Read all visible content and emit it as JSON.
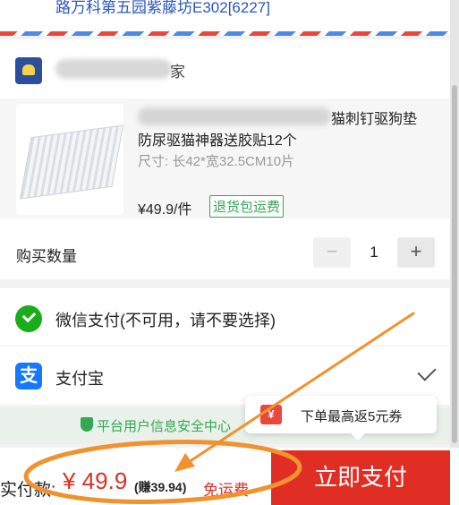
{
  "address": {
    "text": "路万科第五园紫藤坊E302[6227]"
  },
  "shop": {
    "name_suffix": "家",
    "avatar_icon": "shop-avatar-icon"
  },
  "product": {
    "title_line1": "猫刺钉驱狗垫",
    "title_line2": "防尿驱猫神器送胶贴12个",
    "sku": "尺寸: 长42*宽32.5CM10片",
    "price": "¥49.9/件",
    "return_badge": "退货包运费"
  },
  "quantity": {
    "label": "购买数量",
    "minus": "−",
    "value": "1",
    "plus": "+"
  },
  "payment": {
    "wechat_label": "微信支付(不可用，请不要选择)",
    "alipay_label": "支付宝",
    "alipay_icon_glyph": "支",
    "selected": "alipay"
  },
  "security": {
    "text": "平台用户信息安全中心"
  },
  "coupon_tip": {
    "icon_glyph": "¥",
    "text": "下单最高返5元券"
  },
  "bottom": {
    "total_label": "实付款:",
    "total_price": "¥ 49.9",
    "earn": "(赚39.94)",
    "free_shipping": "免运费",
    "pay_button": "立即支付"
  },
  "colors": {
    "accent_red": "#e02e24",
    "green": "#32a852",
    "annotation_orange": "#f0922e"
  }
}
